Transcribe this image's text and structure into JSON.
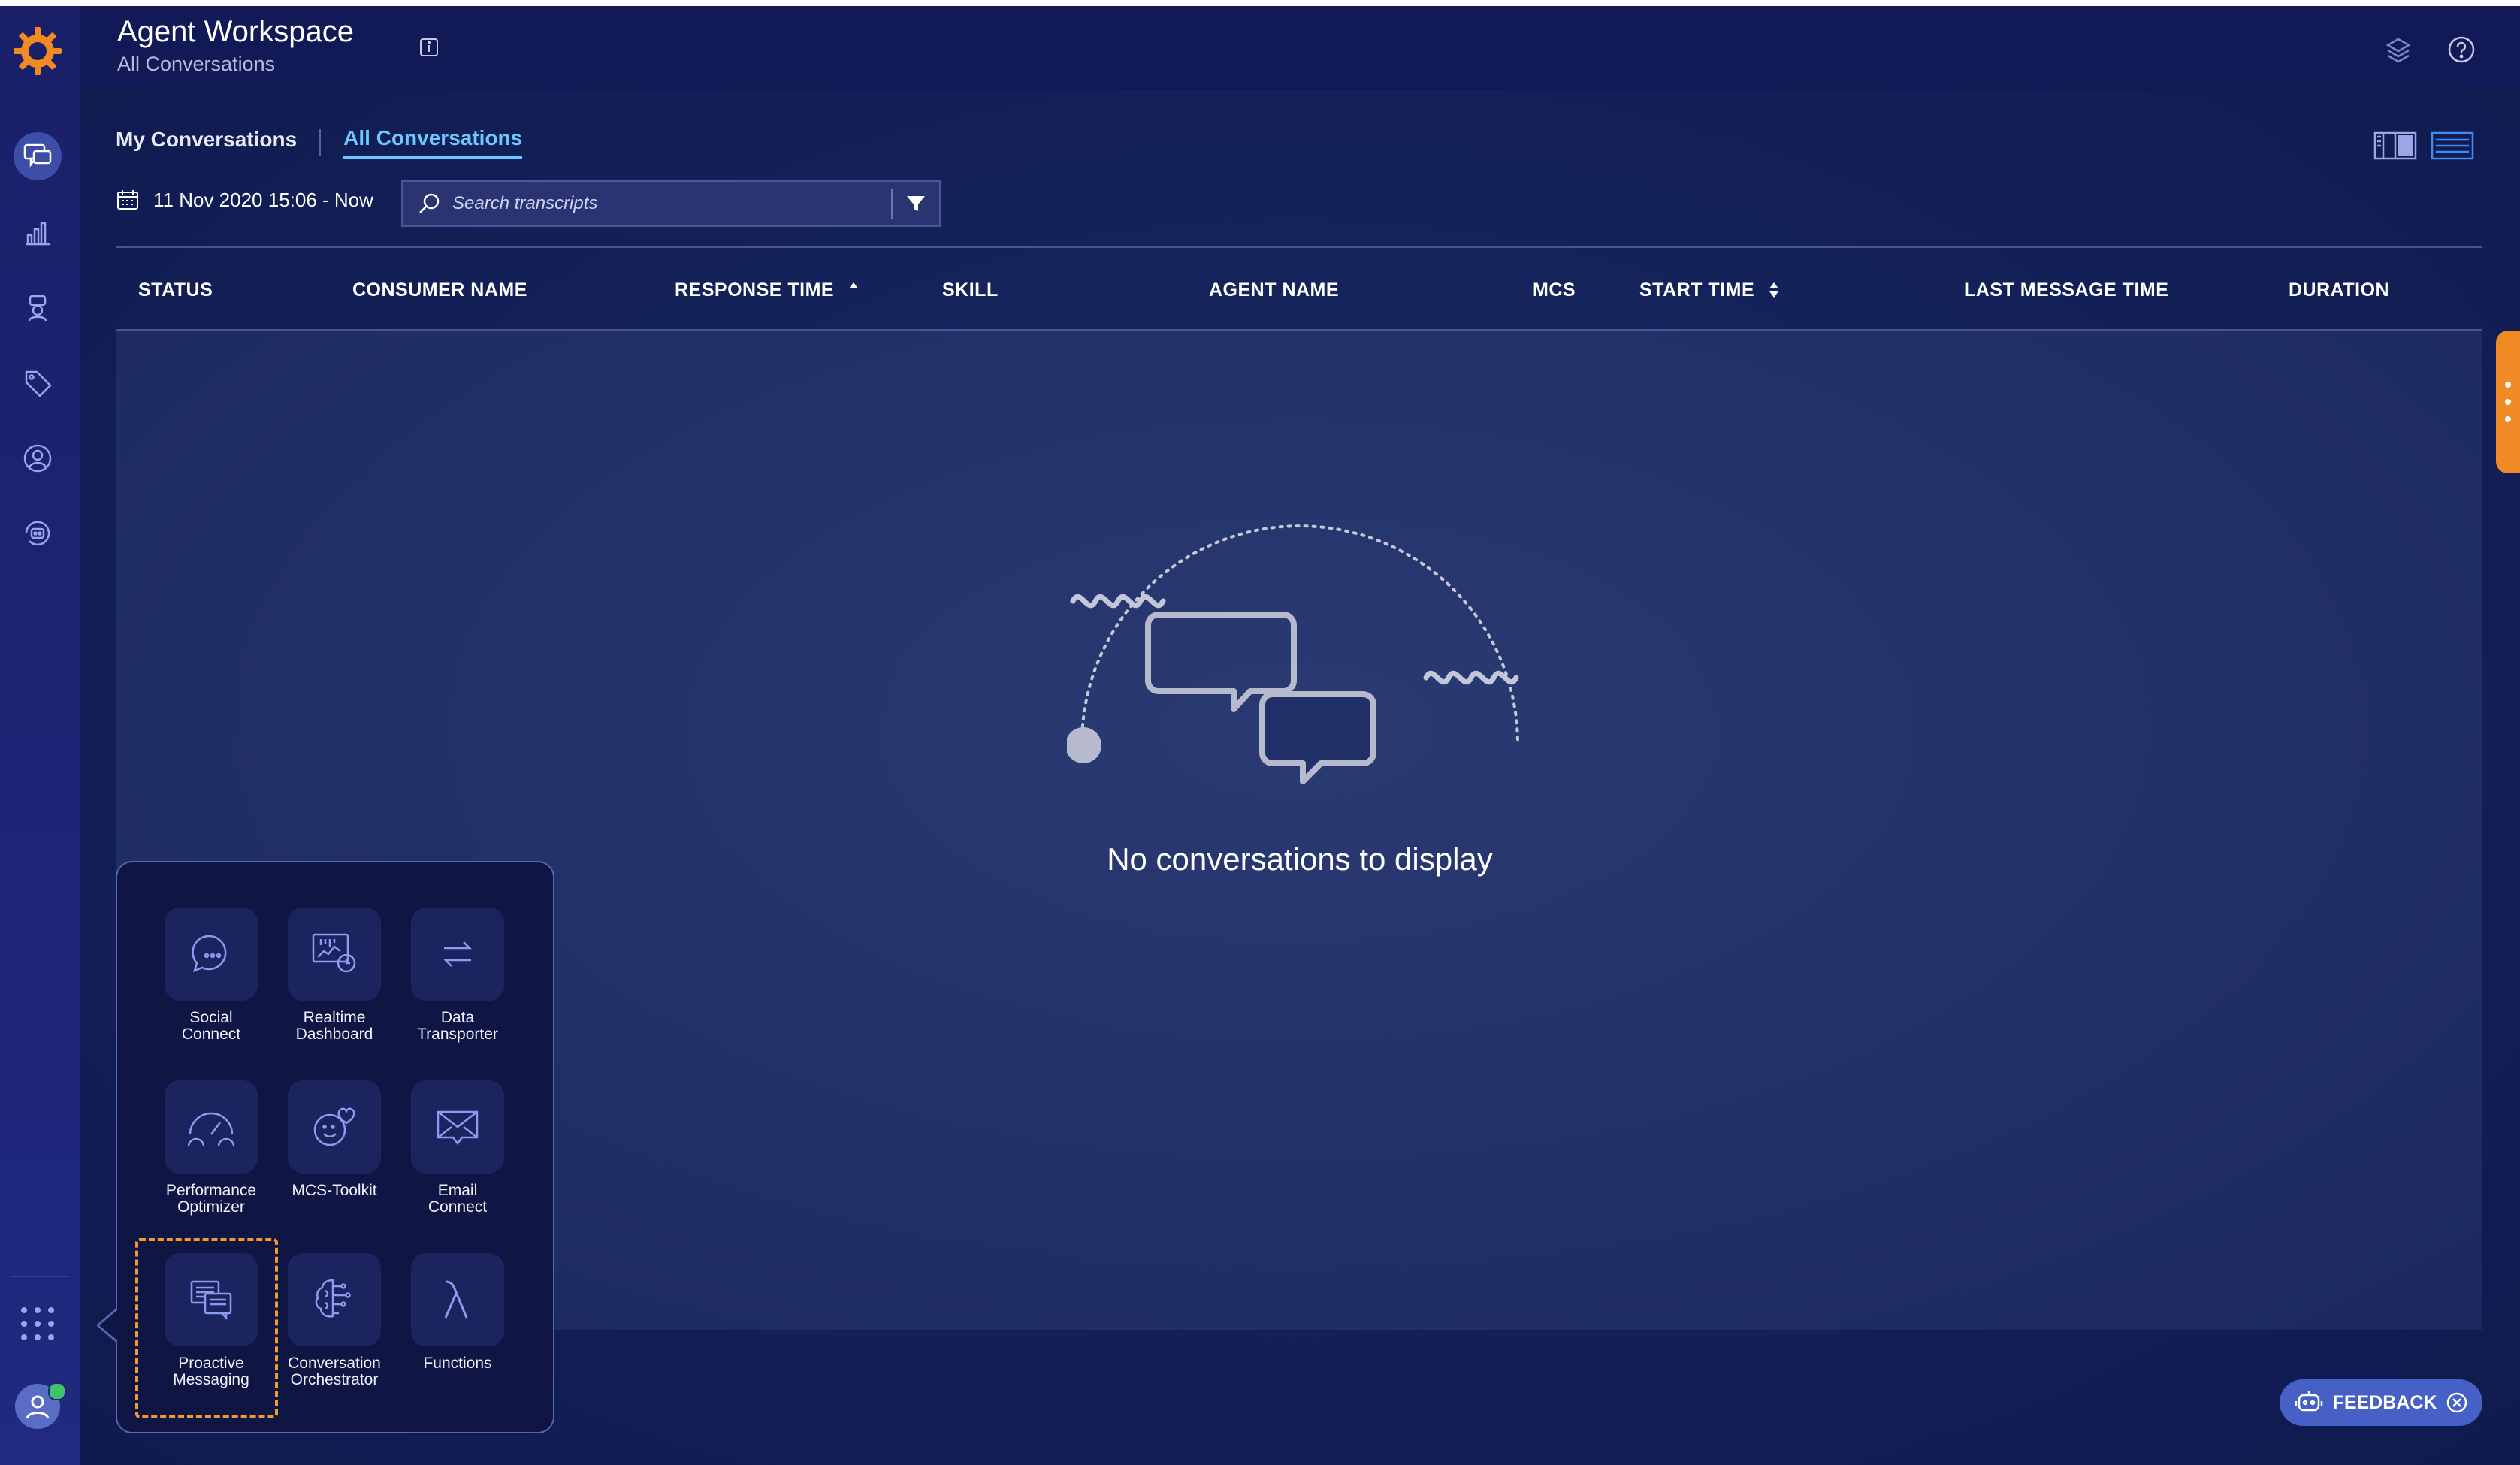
{
  "header": {
    "title": "Agent Workspace",
    "subtitle": "All Conversations"
  },
  "tabs": [
    {
      "label": "My Conversations",
      "active": false
    },
    {
      "label": "All Conversations",
      "active": true
    }
  ],
  "filter": {
    "date_range": "11 Nov 2020 15:06 - Now",
    "search_placeholder": "Search transcripts"
  },
  "table": {
    "columns": [
      "STATUS",
      "CONSUMER NAME",
      "RESPONSE TIME",
      "SKILL",
      "AGENT NAME",
      "MCS",
      "START TIME",
      "LAST MESSAGE TIME",
      "DURATION"
    ],
    "sort": {
      "response_time": "asc",
      "start_time": "both"
    },
    "rows": []
  },
  "empty_state": {
    "message": "No conversations to display"
  },
  "apps_menu": {
    "items": [
      {
        "label": "Social Connect",
        "icon": "social-connect-icon"
      },
      {
        "label": "Realtime Dashboard",
        "icon": "realtime-dashboard-icon"
      },
      {
        "label": "Data Transporter",
        "icon": "data-transporter-icon"
      },
      {
        "label": "Performance Optimizer",
        "icon": "gauge-icon"
      },
      {
        "label": "MCS-Toolkit",
        "icon": "smiley-heart-icon"
      },
      {
        "label": "Email Connect",
        "icon": "envelope-icon"
      },
      {
        "label": "Proactive Messaging",
        "icon": "proactive-messaging-icon",
        "highlighted": true
      },
      {
        "label": "Conversation Orchestrator",
        "icon": "brain-circuit-icon"
      },
      {
        "label": "Functions",
        "icon": "lambda-icon"
      }
    ]
  },
  "feedback": {
    "label": "FEEDBACK"
  },
  "colors": {
    "accent": "#6cc6ff",
    "brand_orange": "#f08a24",
    "highlight": "#f39a2b",
    "status_online": "#3ec26a"
  }
}
